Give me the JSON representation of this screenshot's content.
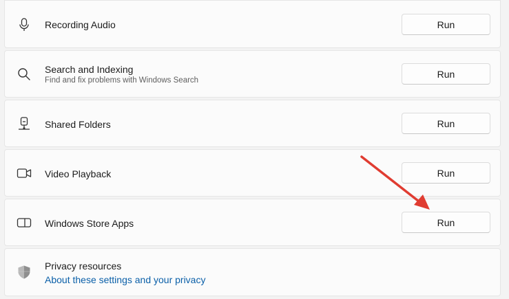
{
  "items": [
    {
      "title": "Recording Audio",
      "subtitle": "",
      "icon": "microphone-icon",
      "button": "Run"
    },
    {
      "title": "Search and Indexing",
      "subtitle": "Find and fix problems with Windows Search",
      "icon": "search-icon",
      "button": "Run"
    },
    {
      "title": "Shared Folders",
      "subtitle": "",
      "icon": "network-drive-icon",
      "button": "Run"
    },
    {
      "title": "Video Playback",
      "subtitle": "",
      "icon": "video-camera-icon",
      "button": "Run"
    },
    {
      "title": "Windows Store Apps",
      "subtitle": "",
      "icon": "app-window-icon",
      "button": "Run"
    }
  ],
  "privacy": {
    "title": "Privacy resources",
    "link": "About these settings and your privacy",
    "icon": "shield-icon"
  },
  "annotation": {
    "arrow_color": "#e03c31",
    "icon": "red-arrow-icon"
  },
  "colors": {
    "link": "#0a5fa8",
    "card_background": "#fbfbfb",
    "page_background": "#f3f3f3"
  }
}
